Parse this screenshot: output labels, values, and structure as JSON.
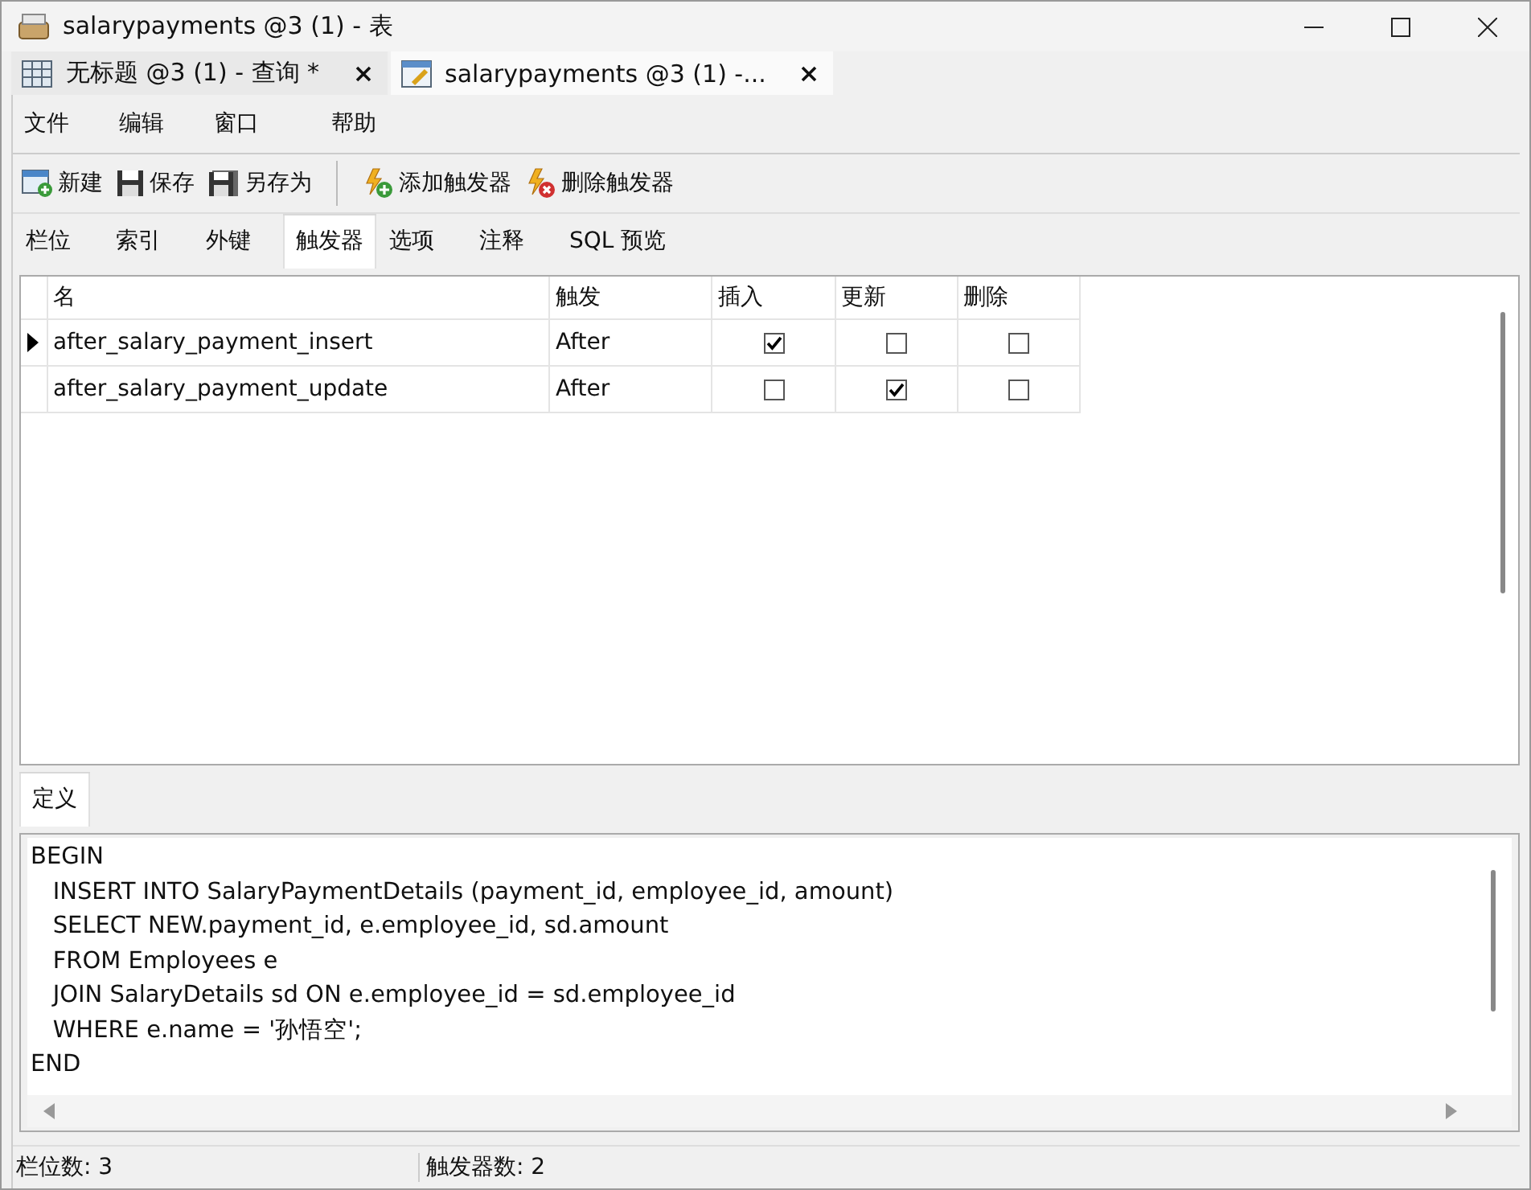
{
  "window": {
    "title": "salarypayments @3 (1) - 表"
  },
  "document_tabs": [
    {
      "label": "无标题 @3 (1) - 查询 *",
      "selected": false,
      "kind": "query"
    },
    {
      "label": "salarypayments @3 (1) -...",
      "selected": true,
      "kind": "table"
    }
  ],
  "menu": [
    "文件",
    "编辑",
    "窗口",
    "帮助"
  ],
  "toolbar": [
    {
      "label": "新建",
      "kind": "new"
    },
    {
      "label": "保存",
      "kind": "save"
    },
    {
      "label": "另存为",
      "kind": "saveas"
    },
    {
      "label": "添加触发器",
      "kind": "add"
    },
    {
      "label": "删除触发器",
      "kind": "delete"
    }
  ],
  "tabs": [
    {
      "label": "栏位",
      "selected": false
    },
    {
      "label": "索引",
      "selected": false
    },
    {
      "label": "外键",
      "selected": false
    },
    {
      "label": "触发器",
      "selected": true
    },
    {
      "label": "选项",
      "selected": false
    },
    {
      "label": "注释",
      "selected": false
    },
    {
      "label": "SQL 预览",
      "selected": false
    }
  ],
  "table": {
    "columns": [
      "名",
      "触发",
      "插入",
      "更新",
      "删除"
    ],
    "rows": [
      {
        "current": true,
        "name": "after_salary_payment_insert",
        "fires": "After",
        "insert": true,
        "update": false,
        "delete": false
      },
      {
        "current": false,
        "name": "after_salary_payment_update",
        "fires": "After",
        "insert": false,
        "update": true,
        "delete": false
      }
    ]
  },
  "definition": {
    "tab": {
      "label": "定义",
      "selected": true
    },
    "lines": [
      "BEGIN",
      "   INSERT INTO SalaryPaymentDetails (payment_id, employee_id, amount)",
      "   SELECT NEW.payment_id, e.employee_id, sd.amount",
      "   FROM Employees e",
      "   JOIN SalaryDetails sd ON e.employee_id = sd.employee_id",
      "   WHERE e.name = '孙悟空';",
      "END"
    ]
  },
  "status_bar": [
    "栏位数: 3",
    "触发器数: 2"
  ]
}
